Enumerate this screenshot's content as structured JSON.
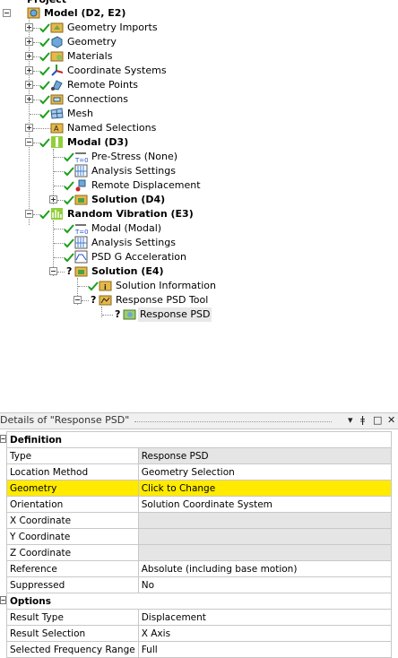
{
  "tree": {
    "project_label": "Project",
    "model_label": "Model (D2, E2)",
    "items": {
      "geometry_imports": "Geometry Imports",
      "geometry": "Geometry",
      "materials": "Materials",
      "coordinate_systems": "Coordinate Systems",
      "remote_points": "Remote Points",
      "connections": "Connections",
      "mesh": "Mesh",
      "named_selections": "Named Selections"
    },
    "modal": {
      "label": "Modal (D3)",
      "pre_stress": "Pre-Stress (None)",
      "analysis_settings": "Analysis Settings",
      "remote_displacement": "Remote Displacement",
      "solution": "Solution (D4)"
    },
    "random_vibration": {
      "label": "Random Vibration (E3)",
      "modal": "Modal (Modal)",
      "analysis_settings": "Analysis Settings",
      "psd_g_accel": "PSD G Acceleration",
      "solution": "Solution (E4)",
      "solution_information": "Solution Information",
      "response_psd_tool": "Response PSD Tool",
      "response_psd": "Response PSD"
    }
  },
  "details": {
    "title": "Details of \"Response PSD\"",
    "buttons": {
      "dropdown": "▾",
      "pin": "ǂ",
      "restore": "□",
      "close": "✕"
    },
    "definition_label": "Definition",
    "definition_rows": [
      {
        "name": "Type",
        "value": "Response PSD"
      },
      {
        "name": "Location Method",
        "value": "Geometry Selection"
      },
      {
        "name": "Geometry",
        "value": "Click to Change"
      },
      {
        "name": "Orientation",
        "value": "Solution Coordinate System"
      },
      {
        "name": "X Coordinate",
        "value": ""
      },
      {
        "name": "Y Coordinate",
        "value": ""
      },
      {
        "name": "Z Coordinate",
        "value": ""
      },
      {
        "name": "Reference",
        "value": "Absolute (including base motion)"
      },
      {
        "name": "Suppressed",
        "value": "No"
      }
    ],
    "options_label": "Options",
    "options_rows": [
      {
        "name": "Result Type",
        "value": "Displacement"
      },
      {
        "name": "Result Selection",
        "value": "X Axis"
      },
      {
        "name": "Selected Frequency Range",
        "value": "Full"
      }
    ]
  },
  "colors": {
    "highlight": "#ffea00",
    "check": "#1aa01a",
    "grid": "#c8c8c8"
  }
}
